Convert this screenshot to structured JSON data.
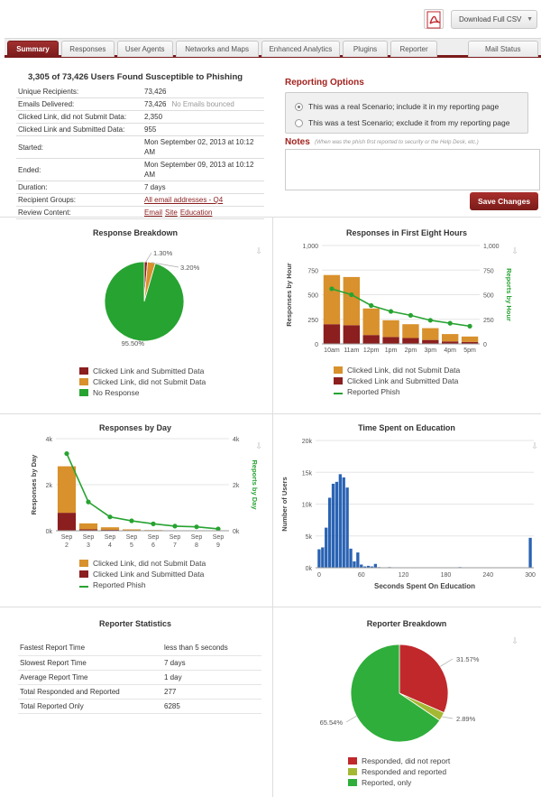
{
  "toolbar": {
    "csv_label": "Download Full CSV",
    "caret": "▼"
  },
  "tabs": [
    {
      "label": "Summary",
      "active": true
    },
    {
      "label": "Responses"
    },
    {
      "label": "User Agents"
    },
    {
      "label": "Networks and Maps"
    },
    {
      "label": "Enhanced Analytics"
    },
    {
      "label": "Plugins"
    },
    {
      "label": "Reporter"
    },
    {
      "label": ""
    },
    {
      "label": "Mail Status"
    }
  ],
  "summary": {
    "title": "3,305 of 73,426 Users Found Susceptible to Phishing",
    "rows": [
      {
        "k": "Unique Recipients:",
        "v": "73,426"
      },
      {
        "k": "Emails Delivered:",
        "v": "73,426",
        "note": "No Emails bounced"
      },
      {
        "k": "Clicked Link, did not Submit Data:",
        "v": "2,350"
      },
      {
        "k": "Clicked Link and Submitted Data:",
        "v": "955"
      },
      {
        "k": "Started:",
        "v": "Mon September 02, 2013 at 10:12 AM"
      },
      {
        "k": "Ended:",
        "v": "Mon September 09, 2013 at 10:12 AM"
      },
      {
        "k": "Duration:",
        "v": "7 days"
      },
      {
        "k": "Recipient Groups:",
        "v": "All email addresses - Q4"
      },
      {
        "k": "Review Content:",
        "links": [
          "Email",
          "Site",
          "Education"
        ]
      }
    ]
  },
  "reporting": {
    "title": "Reporting Options",
    "option_real": "This was a real Scenario; include it in my reporting page",
    "option_test": "This was a test Scenario; exclude it from my reporting page",
    "notes_label": "Notes",
    "notes_hint": "(When was the phish first reported to security or the Help Desk, etc.)",
    "notes_value": "",
    "save_label": "Save Changes"
  },
  "panels": {
    "breakdown_title": "Response Breakdown",
    "hours_title": "Responses in First Eight Hours",
    "days_title": "Responses by Day",
    "education_title": "Time Spent on Education",
    "reporter_stats_title": "Reporter Statistics",
    "reporter_breakdown_title": "Reporter Breakdown"
  },
  "reporter_stats": [
    {
      "k": "Fastest Report Time",
      "v": "less than 5 seconds"
    },
    {
      "k": "Slowest Report Time",
      "v": "7 days"
    },
    {
      "k": "Average Report Time",
      "v": "1 day"
    },
    {
      "k": "Total Responded and Reported",
      "v": "277"
    },
    {
      "k": "Total Reported Only",
      "v": "6285"
    }
  ],
  "colors": {
    "red": "#8b1e1e",
    "orange": "#d8912c",
    "green": "#27a331",
    "accent": "#a3231f",
    "blue": "#2a63b3",
    "pie_red": "#c0282b",
    "pie_olive": "#a5b833",
    "pie_green": "#2fae3b"
  },
  "chart_data": [
    {
      "type": "pie",
      "title": "Response Breakdown",
      "labels": [
        "Clicked Link and Submitted Data",
        "Clicked Link, did not Submit Data",
        "No Response"
      ],
      "values": [
        1.3,
        3.2,
        95.5
      ],
      "value_labels": [
        "1.30%",
        "3.20%",
        "95.50%"
      ]
    },
    {
      "type": "bar",
      "title": "Responses in First Eight Hours",
      "categories": [
        "10am",
        "11am",
        "12pm",
        "1pm",
        "2pm",
        "3pm",
        "4pm",
        "5pm"
      ],
      "series": [
        {
          "name": "Clicked Link and Submitted Data",
          "values": [
            200,
            190,
            90,
            70,
            60,
            40,
            25,
            20
          ]
        },
        {
          "name": "Clicked Link, did not Submit Data",
          "values": [
            500,
            490,
            270,
            170,
            140,
            120,
            75,
            55
          ]
        },
        {
          "name": "Reported Phish",
          "values": [
            560,
            500,
            390,
            330,
            290,
            240,
            210,
            180
          ],
          "axis": "right"
        }
      ],
      "ylabel": "Responses by Hour",
      "ylabel_right": "Reports by Hour",
      "ylim": [
        0,
        1000
      ],
      "yticks": [
        "0",
        "250",
        "500",
        "750",
        "1,000"
      ],
      "legend": [
        "Clicked Link, did not Submit Data",
        "Clicked Link and Submitted Data",
        "Reported Phish"
      ]
    },
    {
      "type": "bar",
      "title": "Responses by Day",
      "categories": [
        "Sep 2",
        "Sep 3",
        "Sep 4",
        "Sep 5",
        "Sep 6",
        "Sep 7",
        "Sep 8",
        "Sep 9"
      ],
      "xticks_top": [
        "Sep",
        "Sep",
        "Sep",
        "Sep",
        "Sep",
        "Sep",
        "Sep",
        "Sep"
      ],
      "xticks_bottom": [
        "2",
        "3",
        "4",
        "5",
        "6",
        "7",
        "8",
        "9"
      ],
      "series": [
        {
          "name": "Clicked Link and Submitted Data",
          "values": [
            780,
            60,
            40,
            20,
            10,
            5,
            5,
            3
          ]
        },
        {
          "name": "Clicked Link, did not Submit Data",
          "values": [
            2020,
            260,
            110,
            40,
            20,
            10,
            5,
            3
          ]
        },
        {
          "name": "Reported Phish",
          "values": [
            3350,
            1250,
            600,
            430,
            300,
            200,
            170,
            80
          ],
          "axis": "right"
        }
      ],
      "ylabel": "Responses by Day",
      "ylabel_right": "Reports by Day",
      "ylim": [
        0,
        4000
      ],
      "yticks": [
        "0k",
        "2k",
        "4k"
      ],
      "legend": [
        "Clicked Link, did not Submit Data",
        "Clicked Link and Submitted Data",
        "Reported Phish"
      ]
    },
    {
      "type": "bar",
      "title": "Time Spent on Education",
      "xlabel": "Seconds Spent On Education",
      "ylabel": "Number of Users",
      "xticks": [
        "0",
        "60",
        "120",
        "180",
        "240",
        "300"
      ],
      "yticks": [
        "0k",
        "5k",
        "10k",
        "15k",
        "20k"
      ],
      "ylim": [
        0,
        20000
      ],
      "xlim": [
        -5,
        305
      ],
      "bins_x": [
        0,
        5,
        10,
        15,
        20,
        25,
        30,
        35,
        40,
        45,
        50,
        55,
        60,
        65,
        70,
        75,
        80,
        85,
        90,
        95,
        100,
        120,
        140,
        160,
        180,
        200,
        220,
        240,
        260,
        280,
        300
      ],
      "bins_y": [
        2900,
        3200,
        6300,
        11000,
        13200,
        13500,
        14700,
        14200,
        12600,
        3000,
        1000,
        2400,
        500,
        200,
        300,
        200,
        600,
        100,
        50,
        50,
        100,
        50,
        50,
        50,
        50,
        100,
        50,
        50,
        50,
        50,
        4700
      ]
    },
    {
      "type": "pie",
      "title": "Reporter Breakdown",
      "labels": [
        "Responded, did not report",
        "Responded and reported",
        "Reported, only"
      ],
      "values": [
        31.57,
        2.89,
        65.54
      ],
      "value_labels": [
        "31.57%",
        "2.89%",
        "65.54%"
      ]
    }
  ]
}
